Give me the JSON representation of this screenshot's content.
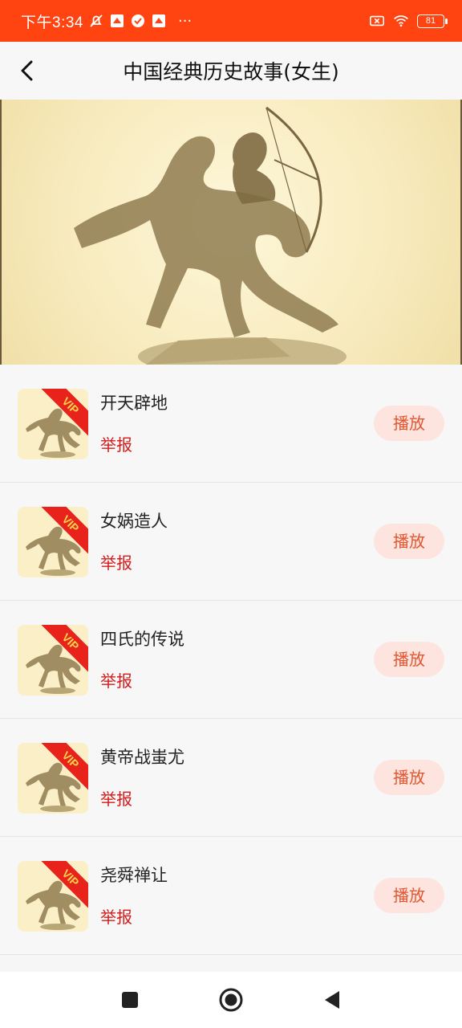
{
  "status_bar": {
    "time": "下午3:34",
    "more": "···",
    "battery": "81",
    "icons": [
      "mute-icon",
      "app-notification-icon",
      "check-circle-icon",
      "app-notification-icon",
      "battery-saver-icon",
      "wifi-icon",
      "battery-icon"
    ]
  },
  "header": {
    "title": "中国经典历史故事(女生)",
    "back_icon": "chevron-left-icon"
  },
  "list": {
    "items": [
      {
        "title": "开天辟地",
        "badge": "VIP",
        "report": "举报",
        "play": "播放"
      },
      {
        "title": "女娲造人",
        "badge": "VIP",
        "report": "举报",
        "play": "播放"
      },
      {
        "title": "四氏的传说",
        "badge": "VIP",
        "report": "举报",
        "play": "播放"
      },
      {
        "title": "黄帝战蚩尤",
        "badge": "VIP",
        "report": "举报",
        "play": "播放"
      },
      {
        "title": "尧舜禅让",
        "badge": "VIP",
        "report": "举报",
        "play": "播放"
      }
    ]
  },
  "nav": {
    "icons": [
      "square-icon",
      "circle-home-icon",
      "triangle-back-icon"
    ]
  },
  "colors": {
    "status_bar": "#ff4412",
    "play_bg": "#fde4df",
    "play_text": "#e2562f",
    "report_text": "#d51b1b",
    "vip_ribbon": "#e8231c",
    "vip_text": "#f6d34a"
  }
}
